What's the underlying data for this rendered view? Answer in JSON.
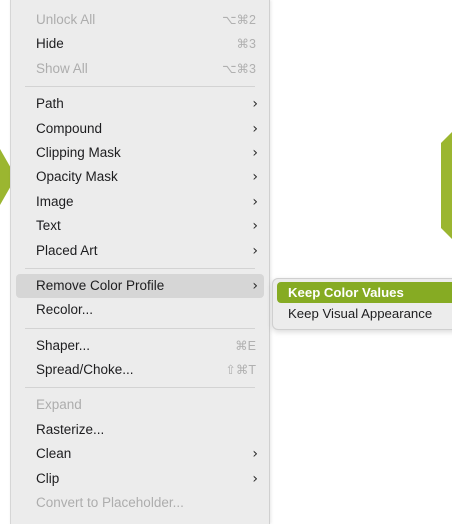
{
  "menu": {
    "groups": [
      [
        {
          "label": "Unlock All",
          "shortcut": "⌥⌘2",
          "disabled": true
        },
        {
          "label": "Hide",
          "shortcut": "⌘3",
          "disabled": false
        },
        {
          "label": "Show All",
          "shortcut": "⌥⌘3",
          "disabled": true
        }
      ],
      [
        {
          "label": "Path",
          "submenu": "›"
        },
        {
          "label": "Compound",
          "submenu": "›"
        },
        {
          "label": "Clipping Mask",
          "submenu": "›"
        },
        {
          "label": "Opacity Mask",
          "submenu": "›"
        },
        {
          "label": "Image",
          "submenu": "›"
        },
        {
          "label": "Text",
          "submenu": "›"
        },
        {
          "label": "Placed Art",
          "submenu": "›"
        }
      ],
      [
        {
          "label": "Remove Color Profile",
          "submenu": "›",
          "selected": true
        },
        {
          "label": "Recolor..."
        }
      ],
      [
        {
          "label": "Shaper...",
          "shortcut": "⌘E"
        },
        {
          "label": "Spread/Choke...",
          "shortcut": "⇧⌘T"
        }
      ],
      [
        {
          "label": "Expand",
          "disabled": true
        },
        {
          "label": "Rasterize..."
        },
        {
          "label": "Clean",
          "submenu": "›"
        },
        {
          "label": "Clip",
          "submenu": "›"
        },
        {
          "label": "Convert to Placeholder...",
          "disabled": true
        }
      ]
    ]
  },
  "submenu": {
    "items": [
      {
        "label": "Keep Color Values",
        "active": true
      },
      {
        "label": "Keep Visual Appearance",
        "active": false
      }
    ]
  },
  "colors": {
    "accent": "#86ab23",
    "arrow": "#9bb630",
    "menu_bg": "#ececec"
  }
}
